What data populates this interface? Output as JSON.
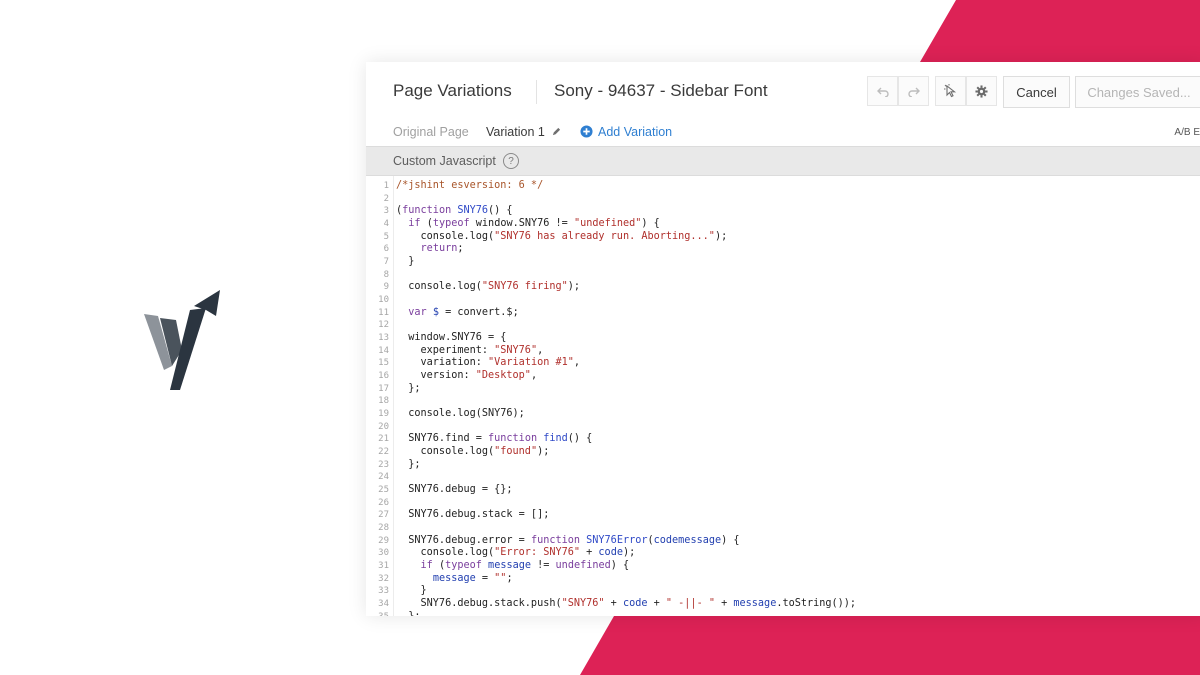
{
  "header": {
    "title": "Page Variations",
    "subtitle": "Sony - 94637 - Sidebar Font",
    "cancel_label": "Cancel",
    "changes_label": "Changes Saved..."
  },
  "tabs": {
    "original": "Original Page",
    "variation": "Variation 1",
    "add": "Add Variation",
    "ab": "A/B E"
  },
  "editor": {
    "label": "Custom Javascript",
    "help": "?"
  },
  "icons": {
    "undo": "undo-icon",
    "redo": "redo-icon",
    "select": "pointer-select-icon",
    "settings": "gear-icon",
    "edit": "pencil-icon",
    "add": "plus-circle-icon"
  },
  "colors": {
    "accent_pink": "#dd2256",
    "link_blue": "#2f7fd1",
    "logo_dark": "#2b3540"
  },
  "code_lines": [
    {
      "n": "1",
      "parts": [
        [
          "cm",
          "/*jshint esversion: 6 */"
        ]
      ]
    },
    {
      "n": "2",
      "parts": []
    },
    {
      "n": "3",
      "parts": [
        [
          "",
          "("
        ],
        [
          "kw",
          "function"
        ],
        [
          "",
          ""
        ],
        [
          "fn",
          " SNY76"
        ],
        [
          "",
          "() {"
        ]
      ]
    },
    {
      "n": "4",
      "parts": [
        [
          "",
          "  "
        ],
        [
          "kw",
          "if"
        ],
        [
          "",
          " ("
        ],
        [
          "kw",
          "typeof"
        ],
        [
          "",
          " window.SNY76 != "
        ],
        [
          "st",
          "\"undefined\""
        ],
        [
          "",
          ") {"
        ]
      ]
    },
    {
      "n": "5",
      "parts": [
        [
          "",
          "    console.log("
        ],
        [
          "st",
          "\"SNY76 has already run. Aborting...\""
        ],
        [
          "",
          ");"
        ]
      ]
    },
    {
      "n": "6",
      "parts": [
        [
          "",
          "    "
        ],
        [
          "kw",
          "return"
        ],
        [
          "",
          ";"
        ]
      ]
    },
    {
      "n": "7",
      "parts": [
        [
          "",
          "  }"
        ]
      ]
    },
    {
      "n": "8",
      "parts": []
    },
    {
      "n": "9",
      "parts": [
        [
          "",
          "  console.log("
        ],
        [
          "st",
          "\"SNY76 firing\""
        ],
        [
          "",
          ");"
        ]
      ]
    },
    {
      "n": "10",
      "parts": []
    },
    {
      "n": "11",
      "parts": [
        [
          "",
          "  "
        ],
        [
          "kw",
          "var"
        ],
        [
          "vr",
          " $"
        ],
        [
          "",
          " = convert.$;"
        ]
      ]
    },
    {
      "n": "12",
      "parts": []
    },
    {
      "n": "13",
      "parts": [
        [
          "",
          "  window.SNY76 = {"
        ]
      ]
    },
    {
      "n": "14",
      "parts": [
        [
          "",
          "    experiment: "
        ],
        [
          "st",
          "\"SNY76\""
        ],
        [
          "",
          ","
        ]
      ]
    },
    {
      "n": "15",
      "parts": [
        [
          "",
          "    variation: "
        ],
        [
          "st",
          "\"Variation #1\""
        ],
        [
          "",
          ","
        ]
      ]
    },
    {
      "n": "16",
      "parts": [
        [
          "",
          "    version: "
        ],
        [
          "st",
          "\"Desktop\""
        ],
        [
          "",
          ","
        ]
      ]
    },
    {
      "n": "17",
      "parts": [
        [
          "",
          "  };"
        ]
      ]
    },
    {
      "n": "18",
      "parts": []
    },
    {
      "n": "19",
      "parts": [
        [
          "",
          "  console.log(SNY76);"
        ]
      ]
    },
    {
      "n": "20",
      "parts": []
    },
    {
      "n": "21",
      "parts": [
        [
          "",
          "  SNY76.find = "
        ],
        [
          "kw",
          "function"
        ],
        [
          "fn",
          " find"
        ],
        [
          "",
          "() {"
        ]
      ]
    },
    {
      "n": "22",
      "parts": [
        [
          "",
          "    console.log("
        ],
        [
          "st",
          "\"found\""
        ],
        [
          "",
          ");"
        ]
      ]
    },
    {
      "n": "23",
      "parts": [
        [
          "",
          "  };"
        ]
      ]
    },
    {
      "n": "24",
      "parts": []
    },
    {
      "n": "25",
      "parts": [
        [
          "",
          "  SNY76.debug = {};"
        ]
      ]
    },
    {
      "n": "26",
      "parts": []
    },
    {
      "n": "27",
      "parts": [
        [
          "",
          "  SNY76.debug.stack = [];"
        ]
      ]
    },
    {
      "n": "28",
      "parts": []
    },
    {
      "n": "29",
      "parts": [
        [
          "",
          "  SNY76.debug.error = "
        ],
        [
          "kw",
          "function"
        ],
        [
          "fn",
          " SNY76Error"
        ],
        [
          "",
          "("
        ],
        [
          "vr",
          "code"
        ],
        [
          ", ",
          ""
        ],
        [
          "vr",
          "message"
        ],
        [
          "",
          ") {"
        ]
      ]
    },
    {
      "n": "30",
      "parts": [
        [
          "",
          "    console.log("
        ],
        [
          "st",
          "\"Error: SNY76\""
        ],
        [
          "",
          " + "
        ],
        [
          "vr",
          "code"
        ],
        [
          "",
          ");"
        ]
      ]
    },
    {
      "n": "31",
      "parts": [
        [
          "",
          "    "
        ],
        [
          "kw",
          "if"
        ],
        [
          "",
          " ("
        ],
        [
          "kw",
          "typeof"
        ],
        [
          "vr",
          " message"
        ],
        [
          "",
          " != "
        ],
        [
          "kw",
          "undefined"
        ],
        [
          "",
          ") {"
        ]
      ]
    },
    {
      "n": "32",
      "parts": [
        [
          "",
          "      "
        ],
        [
          "vr",
          "message"
        ],
        [
          "",
          " = "
        ],
        [
          "st",
          "\"\""
        ],
        [
          "",
          ";"
        ]
      ]
    },
    {
      "n": "33",
      "parts": [
        [
          "",
          "    }"
        ]
      ]
    },
    {
      "n": "34",
      "parts": [
        [
          "",
          "    SNY76.debug.stack.push("
        ],
        [
          "st",
          "\"SNY76\""
        ],
        [
          "",
          " + "
        ],
        [
          "vr",
          "code"
        ],
        [
          "",
          " + "
        ],
        [
          "st",
          "\" -||- \""
        ],
        [
          "",
          " + "
        ],
        [
          "vr",
          "message"
        ],
        [
          "",
          ".toString());"
        ]
      ]
    },
    {
      "n": "35",
      "parts": [
        [
          "",
          "  };"
        ]
      ]
    }
  ]
}
